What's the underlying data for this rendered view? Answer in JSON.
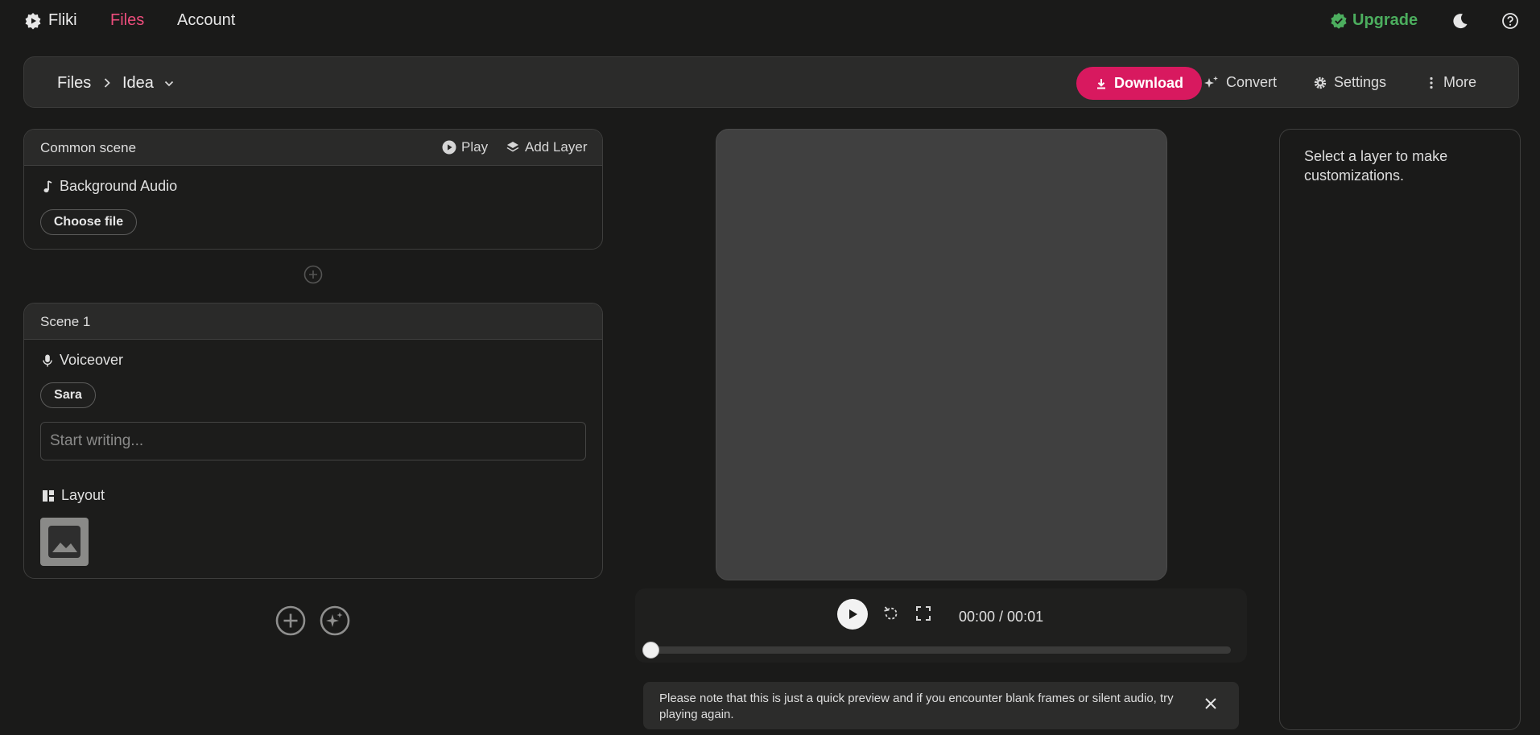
{
  "nav": {
    "brand": "Fliki",
    "links": [
      "Files",
      "Account"
    ],
    "upgrade": "Upgrade"
  },
  "breadcrumb": {
    "root": "Files",
    "current": "Idea"
  },
  "toolbar": {
    "download": "Download",
    "convert": "Convert",
    "settings": "Settings",
    "more": "More"
  },
  "common_scene": {
    "title": "Common scene",
    "play": "Play",
    "add_layer": "Add Layer",
    "background_audio": "Background Audio",
    "choose_file": "Choose file"
  },
  "scene1": {
    "title": "Scene 1",
    "voiceover": "Voiceover",
    "voice": "Sara",
    "input_value": "",
    "input_placeholder": "Start writing...",
    "layout": "Layout"
  },
  "player": {
    "timecode": "00:00 / 00:01",
    "progress": 0
  },
  "notice": {
    "text": "Please note that this is just a quick preview and if you encounter blank frames or silent audio, try playing again."
  },
  "right_panel": {
    "hint": "Select a layer to make customizations."
  },
  "colors": {
    "accent": "#d8195f",
    "active_link": "#ec4d7c",
    "upgrade": "#4cae5e",
    "background": "#1a1a19"
  },
  "icons": [
    "fliki-logo-icon",
    "verified-badge-icon",
    "moon-icon",
    "help-icon",
    "chevron-right-icon",
    "chevron-down-icon",
    "download-icon",
    "sparkle-icon",
    "gear-icon",
    "more-vertical-icon",
    "play-circle-icon",
    "layers-icon",
    "music-note-icon",
    "add-circle-icon",
    "mic-icon",
    "layout-icon",
    "image-icon",
    "magic-circle-icon",
    "play-icon",
    "replay-icon",
    "fullscreen-icon",
    "close-icon"
  ]
}
